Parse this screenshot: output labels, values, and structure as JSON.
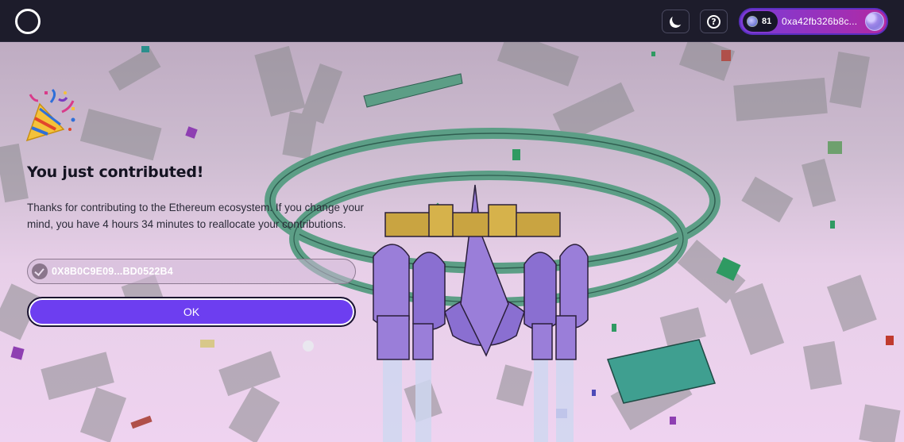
{
  "header": {
    "logo_icon": "circle-logo-icon",
    "theme_icon": "moon-icon",
    "help_icon": "question-circle-icon",
    "help_glyph": "?",
    "wallet": {
      "count": "81",
      "address": "0xa42fb326b8c...",
      "avatar_icon": "avatar-icon"
    }
  },
  "modal": {
    "icon": "party-popper-icon",
    "title": "You just contributed!",
    "message": "Thanks for contributing to the Ethereum ecosystem. If you change your mind, you have 4 hours 34 minutes to reallocate your contributions.",
    "address": "0X8B0C9E09...BD0522B4",
    "address_icon": "check-circle-icon",
    "ok_label": "OK"
  },
  "colors": {
    "topbar": "#1d1c2b",
    "accent": "#6d3ef0",
    "wallet_gradient_start": "#7b3bd6",
    "wallet_gradient_end": "#b32aa0",
    "background_top": "#b9a6bd",
    "background_bottom": "#efd3f0"
  }
}
